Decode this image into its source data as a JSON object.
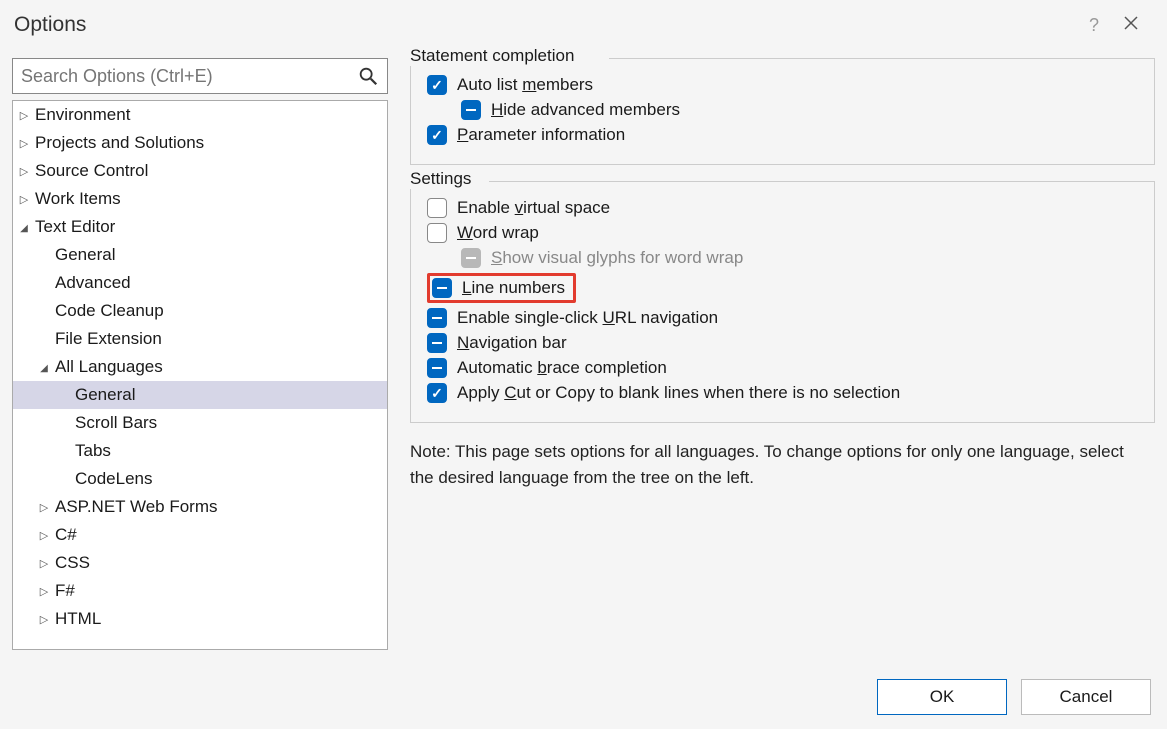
{
  "window": {
    "title": "Options",
    "help_tooltip": "?",
    "close_tooltip": "×"
  },
  "search": {
    "placeholder": "Search Options (Ctrl+E)"
  },
  "tree": [
    {
      "label": "Environment",
      "indent": 0,
      "state": "collapsed"
    },
    {
      "label": "Projects and Solutions",
      "indent": 0,
      "state": "collapsed"
    },
    {
      "label": "Source Control",
      "indent": 0,
      "state": "collapsed"
    },
    {
      "label": "Work Items",
      "indent": 0,
      "state": "collapsed"
    },
    {
      "label": "Text Editor",
      "indent": 0,
      "state": "expanded"
    },
    {
      "label": "General",
      "indent": 1,
      "state": "none"
    },
    {
      "label": "Advanced",
      "indent": 1,
      "state": "none"
    },
    {
      "label": "Code Cleanup",
      "indent": 1,
      "state": "none"
    },
    {
      "label": "File Extension",
      "indent": 1,
      "state": "none"
    },
    {
      "label": "All Languages",
      "indent": 1,
      "state": "expanded"
    },
    {
      "label": "General",
      "indent": 2,
      "state": "none",
      "selected": true
    },
    {
      "label": "Scroll Bars",
      "indent": 2,
      "state": "none"
    },
    {
      "label": "Tabs",
      "indent": 2,
      "state": "none"
    },
    {
      "label": "CodeLens",
      "indent": 2,
      "state": "none"
    },
    {
      "label": "ASP.NET Web Forms",
      "indent": 1,
      "state": "collapsed"
    },
    {
      "label": "C#",
      "indent": 1,
      "state": "collapsed"
    },
    {
      "label": "CSS",
      "indent": 1,
      "state": "collapsed"
    },
    {
      "label": "F#",
      "indent": 1,
      "state": "collapsed"
    },
    {
      "label": "HTML",
      "indent": 1,
      "state": "collapsed"
    }
  ],
  "groups": {
    "statement": {
      "legend": "Statement completion",
      "auto_list": {
        "pre": "Auto list ",
        "u": "m",
        "post": "embers",
        "state": "checked"
      },
      "hide_adv": {
        "pre": "",
        "u": "H",
        "post": "ide advanced members",
        "state": "indeterminate"
      },
      "param_info": {
        "pre": "",
        "u": "P",
        "post": "arameter information",
        "state": "checked"
      }
    },
    "settings": {
      "legend": "Settings",
      "virtual_space": {
        "pre": "Enable ",
        "u": "v",
        "post": "irtual space",
        "state": "unchecked"
      },
      "word_wrap": {
        "pre": "",
        "u": "W",
        "post": "ord wrap",
        "state": "unchecked"
      },
      "glyphs": {
        "pre": "",
        "u": "S",
        "post": "how visual glyphs for word wrap",
        "state": "disabled"
      },
      "line_numbers": {
        "pre": "",
        "u": "L",
        "post": "ine numbers",
        "state": "indeterminate",
        "highlighted": true
      },
      "url_nav": {
        "pre": "Enable single-click ",
        "u": "U",
        "post": "RL navigation",
        "state": "indeterminate"
      },
      "nav_bar": {
        "pre": "",
        "u": "N",
        "post": "avigation bar",
        "state": "indeterminate"
      },
      "brace": {
        "pre": "Automatic ",
        "u": "b",
        "post": "race completion",
        "state": "indeterminate"
      },
      "cut_copy": {
        "pre": "Apply ",
        "u": "C",
        "post": "ut or Copy to blank lines when there is no selection",
        "state": "checked"
      }
    }
  },
  "note": "Note: This page sets options for all languages. To change options for only one language, select the desired language from the tree on the left.",
  "buttons": {
    "ok": "OK",
    "cancel": "Cancel"
  }
}
